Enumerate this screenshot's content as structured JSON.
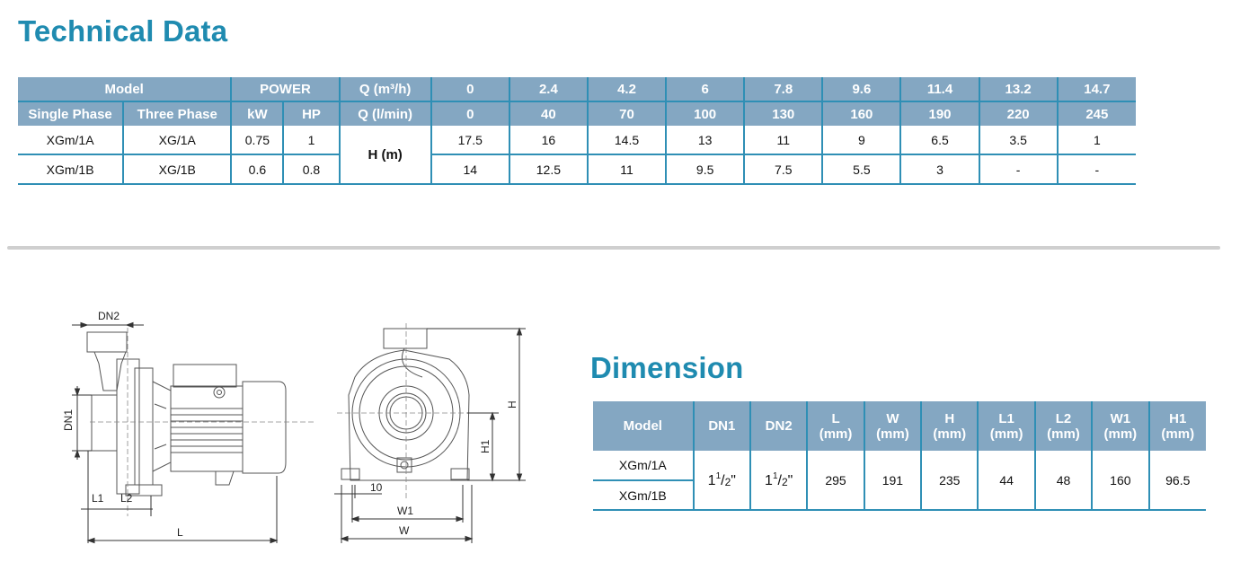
{
  "technical": {
    "title": "Technical Data",
    "header_row1": {
      "model": "Model",
      "power": "POWER",
      "q_m3h_label": "Q (m³/h)",
      "q_m3h": [
        "0",
        "2.4",
        "4.2",
        "6",
        "7.8",
        "9.6",
        "11.4",
        "13.2",
        "14.7"
      ]
    },
    "header_row2": {
      "single_phase": "Single Phase",
      "three_phase": "Three Phase",
      "kw": "kW",
      "hp": "HP",
      "q_lmin_label": "Q (l/min)",
      "q_lmin": [
        "0",
        "40",
        "70",
        "100",
        "130",
        "160",
        "190",
        "220",
        "245"
      ]
    },
    "head_label": "H (m)",
    "rows": [
      {
        "single": "XGm/1A",
        "three": "XG/1A",
        "kw": "0.75",
        "hp": "1",
        "h": [
          "17.5",
          "16",
          "14.5",
          "13",
          "11",
          "9",
          "6.5",
          "3.5",
          "1"
        ]
      },
      {
        "single": "XGm/1B",
        "three": "XG/1B",
        "kw": "0.6",
        "hp": "0.8",
        "h": [
          "14",
          "12.5",
          "11",
          "9.5",
          "7.5",
          "5.5",
          "3",
          "-",
          "-"
        ]
      }
    ]
  },
  "dimension": {
    "title": "Dimension",
    "headers": {
      "model": "Model",
      "dn1": "DN1",
      "dn2": "DN2",
      "l": "L",
      "w": "W",
      "h": "H",
      "l1": "L1",
      "l2": "L2",
      "w1": "W1",
      "h1": "H1",
      "unit": "(mm)"
    },
    "models": [
      "XGm/1A",
      "XGm/1B"
    ],
    "values": {
      "dn1": {
        "whole": "1",
        "num": "1",
        "den": "2",
        "mark": "\""
      },
      "dn2": {
        "whole": "1",
        "num": "1",
        "den": "2",
        "mark": "\""
      },
      "l": "295",
      "w": "191",
      "h": "235",
      "l1": "44",
      "l2": "48",
      "w1": "160",
      "h1": "96.5"
    }
  },
  "drawing_labels": {
    "dn2": "DN2",
    "dn1": "DN1",
    "l1": "L1",
    "l2": "L2",
    "l": "L",
    "h": "H",
    "h1": "H1",
    "ten": "10",
    "w1": "W1",
    "w": "W"
  }
}
